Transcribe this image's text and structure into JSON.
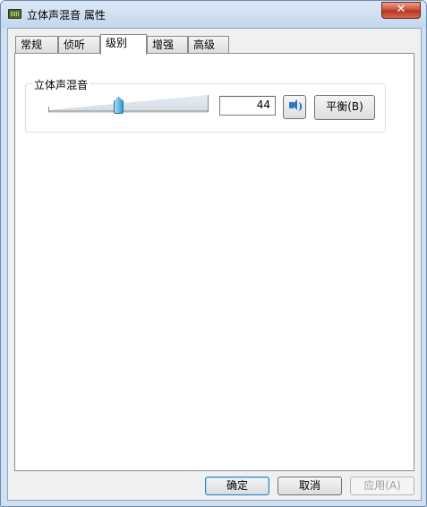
{
  "window": {
    "title": "立体声混音 属性",
    "close_label": "✕"
  },
  "tabs": [
    {
      "label": "常规",
      "active": false
    },
    {
      "label": "侦听",
      "active": false
    },
    {
      "label": "级别",
      "active": true
    },
    {
      "label": "增强",
      "active": false
    },
    {
      "label": "高级",
      "active": false
    }
  ],
  "levels": {
    "group_label": "立体声混音",
    "volume_value": "44",
    "volume_level": 44,
    "mute_icon": "speaker-icon",
    "balance_label": "平衡(B)"
  },
  "footer": {
    "ok_label": "确定",
    "cancel_label": "取消",
    "apply_label": "应用(A)"
  },
  "colors": {
    "accent": "#3a98cc",
    "speaker": "#2a78c8"
  }
}
